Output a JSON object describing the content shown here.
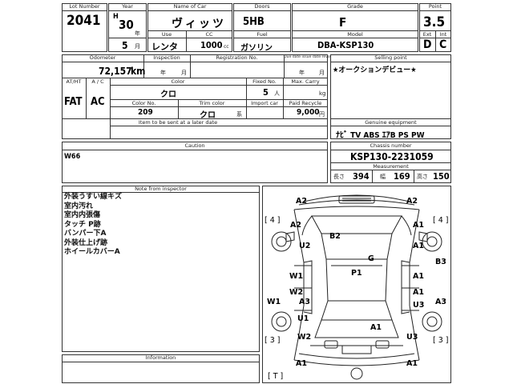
{
  "headers": {
    "lot_number": "Lot Number",
    "year": "Year",
    "name_of_car": "Name of Car",
    "doors": "Doors",
    "grade": "Grade",
    "point": "Point",
    "use": "Use",
    "cc": "CC",
    "fuel": "Fuel",
    "model": "Model",
    "ext": "Ext",
    "int": "Int",
    "odometer": "Odometer",
    "inspection": "Inspection",
    "registration_no": "Registration No.",
    "due_date_changed": "Due date issue date revoke",
    "selling_point": "Selling point",
    "at_ht": "AT/HT",
    "ac": "A / C",
    "color": "Color",
    "fixed_no": "Fixed No.",
    "max_carry": "Max. Carry",
    "color_no": "Color No.",
    "trim_color": "Trim color",
    "import_car": "Import car",
    "paid_recycle": "Paid Recycle",
    "item_to_be_sent": "Item to be sent at a later date",
    "genuine_equipment": "Genuine equipment",
    "caution": "Caution",
    "chassis_number": "Chassis number",
    "measurement": "Measurement",
    "note_from_inspector": "Note from inspector",
    "information": "Information"
  },
  "values": {
    "lot_number": "2041",
    "year_era": "H",
    "year_num": "30",
    "year_unit": "年",
    "month_num": "5",
    "month_unit": "月",
    "name_of_car": "ヴィッツ",
    "doors": "5HB",
    "grade": "F",
    "point": "3.5",
    "use": "レンタ",
    "cc_value": "1000",
    "cc_unit": "cc",
    "fuel": "ガソリン",
    "model": "DBA-KSP130",
    "ext": "D",
    "int": "C",
    "odometer": "72,157",
    "odometer_unit": "km",
    "inspection_year_unit": "年",
    "inspection_month_unit": "月",
    "due_year_unit": "年",
    "due_month_unit": "月",
    "selling_point": "★オークションデビュー★",
    "at_ht": "FAT",
    "ac": "AC",
    "color": "クロ",
    "fixed_no": "5",
    "fixed_no_unit": "人",
    "max_carry_unit": "kg",
    "color_no": "209",
    "trim_color": "クロ",
    "trim_suffix": "系",
    "paid_recycle": "9,000",
    "paid_recycle_unit": "円",
    "genuine_equipment": "ﾅﾋﾞ TV ABS ｴｱB PS PW",
    "caution": "W66",
    "chassis_number": "KSP130-2231059",
    "length_label": "長さ",
    "length": "394",
    "width_label": "幅",
    "width": "169",
    "height_label": "高さ",
    "height": "150"
  },
  "inspector_notes": [
    "外装うすい線キズ",
    "室内汚れ",
    "室内内張傷",
    "タッチ P跡",
    "バンパー下A",
    "外装仕上げ跡",
    "ホイールカバーA"
  ],
  "diagram_marks": {
    "m1": "A2",
    "m2": "A2",
    "m3": "A2",
    "m4": "A1",
    "m5": "B2",
    "m6": "U2",
    "m7": "A1",
    "m8": "B3",
    "m9": "G",
    "m10": "P1",
    "m11": "W1",
    "m12": "A1",
    "m13": "W2",
    "m14": "A1",
    "m15": "W1",
    "m16": "U3",
    "m17": "A3",
    "m18": "A3",
    "m19": "U1",
    "m20": "A1",
    "m21": "W2",
    "m22": "U3",
    "m23": "A1",
    "m24": "A1",
    "tire_fl": "[ 4 ]",
    "tire_fr": "[ 4 ]",
    "tire_rl": "[ 3 ]",
    "tire_rr": "[ 3 ]",
    "tire_spare": "[ T ]"
  }
}
